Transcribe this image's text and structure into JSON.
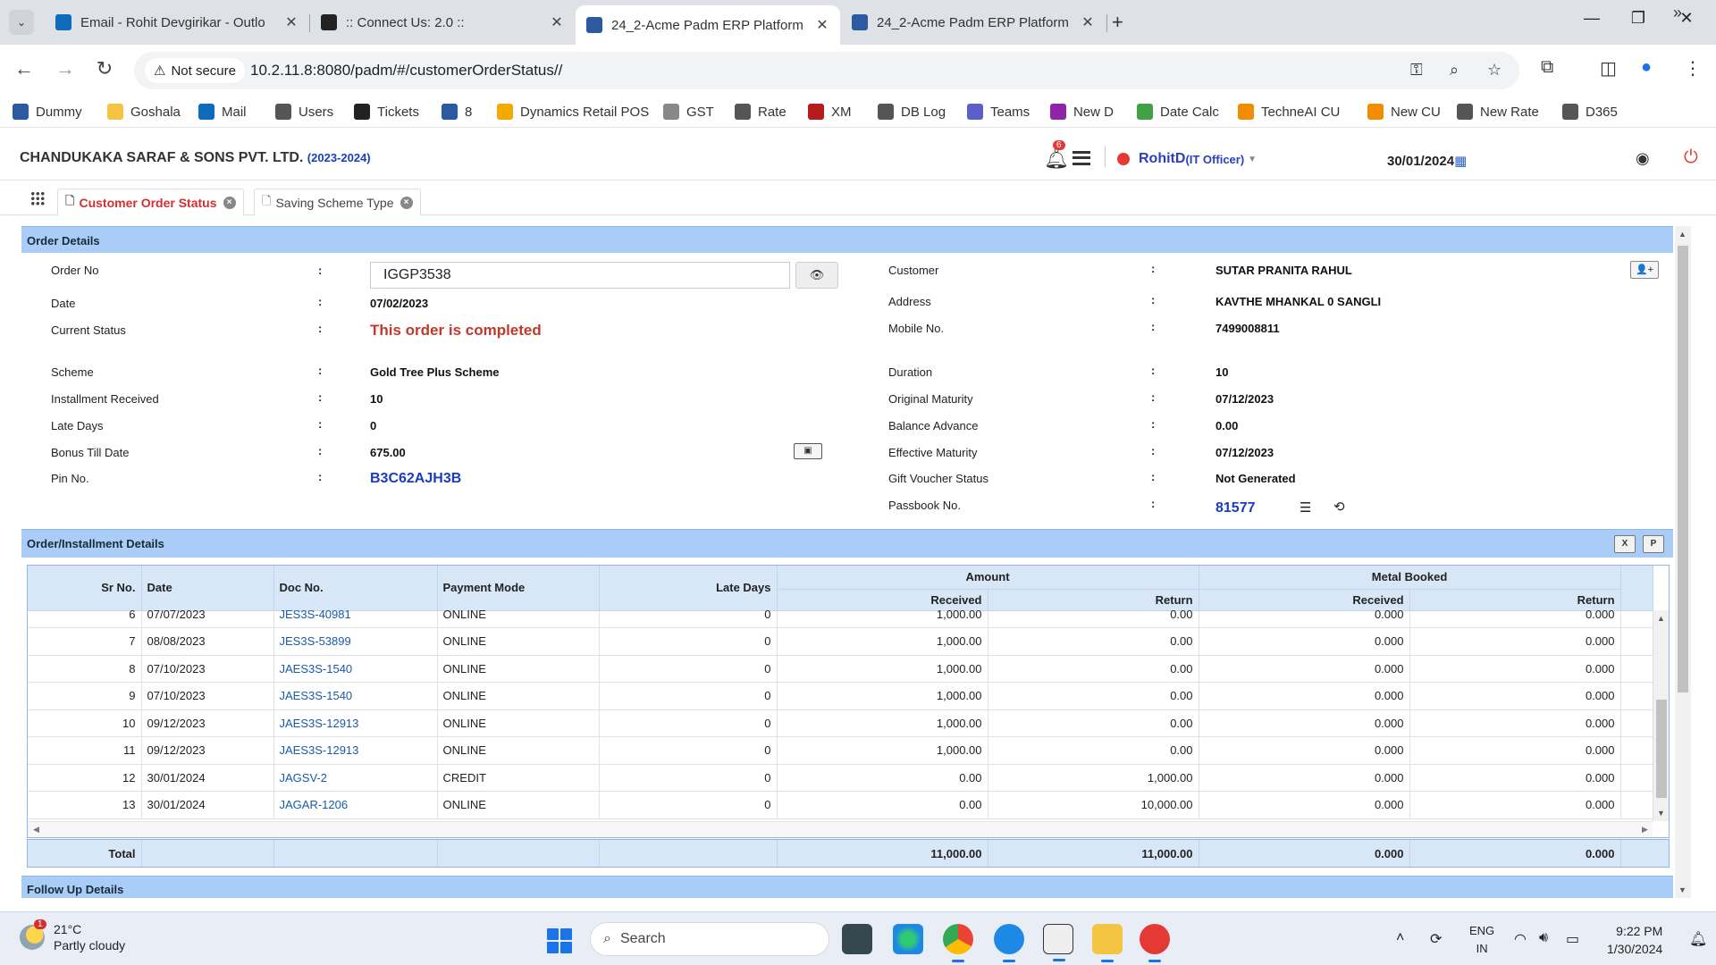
{
  "browser": {
    "tabs": [
      {
        "title": "Email - Rohit Devgirikar - Outlo",
        "color": "#0f6cbd"
      },
      {
        "title": ":: Connect Us: 2.0 ::",
        "color": "#222222"
      },
      {
        "title": "24_2-Acme Padm ERP Platform",
        "color": "#2c5aa0"
      },
      {
        "title": "24_2-Acme Padm ERP Platform",
        "color": "#2c5aa0"
      }
    ],
    "security_label": "Not secure",
    "url": "10.2.11.8:8080/padm/#/customerOrderStatus//"
  },
  "bookmarks": [
    {
      "label": "Dummy",
      "color": "#2c5aa0"
    },
    {
      "label": "Goshala",
      "color": "#f4c542"
    },
    {
      "label": "Mail",
      "color": "#0f6cbd"
    },
    {
      "label": "Users",
      "color": "#555555"
    },
    {
      "label": "Tickets",
      "color": "#222222"
    },
    {
      "label": "8",
      "color": "#2c5aa0"
    },
    {
      "label": "Dynamics Retail POS",
      "color": "#f2a900"
    },
    {
      "label": "GST",
      "color": "#888888"
    },
    {
      "label": "Rate",
      "color": "#555555"
    },
    {
      "label": "XM",
      "color": "#b71c1c"
    },
    {
      "label": "DB Log",
      "color": "#555555"
    },
    {
      "label": "Teams",
      "color": "#5b5fc7"
    },
    {
      "label": "New D",
      "color": "#8e24aa"
    },
    {
      "label": "Date Calc",
      "color": "#43a047"
    },
    {
      "label": "TechneAI CU",
      "color": "#f28c00"
    },
    {
      "label": "New CU",
      "color": "#f28c00"
    },
    {
      "label": "New Rate",
      "color": "#555555"
    },
    {
      "label": "D365",
      "color": "#555555"
    }
  ],
  "header": {
    "company": "CHANDUKAKA SARAF & SONS PVT. LTD.",
    "fiscal_year": "(2023-2024)",
    "notification_count": "6",
    "user_name": "RohitD",
    "user_role": "(IT Officer)",
    "date": "30/01/2024"
  },
  "page_tabs": [
    {
      "label": "Customer Order Status"
    },
    {
      "label": "Saving Scheme Type"
    }
  ],
  "order_details": {
    "section_title": "Order Details",
    "order_no_label": "Order No",
    "order_no": "IGGP3538",
    "date_label": "Date",
    "date": "07/02/2023",
    "status_label": "Current Status",
    "status": "This order is completed",
    "scheme_label": "Scheme",
    "scheme": "Gold Tree Plus Scheme",
    "installment_label": "Installment Received",
    "installment": "10",
    "late_days_label": "Late Days",
    "late_days": "0",
    "bonus_label": "Bonus Till Date",
    "bonus": "675.00",
    "pin_label": "Pin No.",
    "pin": "B3C62AJH3B",
    "customer_label": "Customer",
    "customer": "SUTAR PRANITA RAHUL",
    "address_label": "Address",
    "address": "KAVTHE MHANKAL 0 SANGLI",
    "mobile_label": "Mobile No.",
    "mobile": "7499008811",
    "duration_label": "Duration",
    "duration": "10",
    "orig_maturity_label": "Original Maturity",
    "orig_maturity": "07/12/2023",
    "balance_label": "Balance Advance",
    "balance": "0.00",
    "eff_maturity_label": "Effective Maturity",
    "eff_maturity": "07/12/2023",
    "voucher_label": "Gift Voucher Status",
    "voucher": "Not Generated",
    "passbook_label": "Passbook No.",
    "passbook": "81577"
  },
  "installments": {
    "section_title": "Order/Installment Details",
    "headers": {
      "sr": "Sr No.",
      "date": "Date",
      "doc": "Doc No.",
      "mode": "Payment Mode",
      "late": "Late Days",
      "amount": "Amount",
      "metal": "Metal Booked",
      "received": "Received",
      "return": "Return"
    },
    "rows": [
      {
        "sr": "6",
        "date": "07/07/2023",
        "doc": "JES3S-40981",
        "mode": "ONLINE",
        "late": "0",
        "amt_rec": "1,000.00",
        "amt_ret": "0.00",
        "met_rec": "0.000",
        "met_ret": "0.000"
      },
      {
        "sr": "7",
        "date": "08/08/2023",
        "doc": "JES3S-53899",
        "mode": "ONLINE",
        "late": "0",
        "amt_rec": "1,000.00",
        "amt_ret": "0.00",
        "met_rec": "0.000",
        "met_ret": "0.000"
      },
      {
        "sr": "8",
        "date": "07/10/2023",
        "doc": "JAES3S-1540",
        "mode": "ONLINE",
        "late": "0",
        "amt_rec": "1,000.00",
        "amt_ret": "0.00",
        "met_rec": "0.000",
        "met_ret": "0.000"
      },
      {
        "sr": "9",
        "date": "07/10/2023",
        "doc": "JAES3S-1540",
        "mode": "ONLINE",
        "late": "0",
        "amt_rec": "1,000.00",
        "amt_ret": "0.00",
        "met_rec": "0.000",
        "met_ret": "0.000"
      },
      {
        "sr": "10",
        "date": "09/12/2023",
        "doc": "JAES3S-12913",
        "mode": "ONLINE",
        "late": "0",
        "amt_rec": "1,000.00",
        "amt_ret": "0.00",
        "met_rec": "0.000",
        "met_ret": "0.000"
      },
      {
        "sr": "11",
        "date": "09/12/2023",
        "doc": "JAES3S-12913",
        "mode": "ONLINE",
        "late": "0",
        "amt_rec": "1,000.00",
        "amt_ret": "0.00",
        "met_rec": "0.000",
        "met_ret": "0.000"
      },
      {
        "sr": "12",
        "date": "30/01/2024",
        "doc": "JAGSV-2",
        "mode": "CREDIT",
        "late": "0",
        "amt_rec": "0.00",
        "amt_ret": "1,000.00",
        "met_rec": "0.000",
        "met_ret": "0.000"
      },
      {
        "sr": "13",
        "date": "30/01/2024",
        "doc": "JAGAR-1206",
        "mode": "ONLINE",
        "late": "0",
        "amt_rec": "0.00",
        "amt_ret": "10,000.00",
        "met_rec": "0.000",
        "met_ret": "0.000"
      }
    ],
    "total_label": "Total",
    "totals": {
      "amt_rec": "11,000.00",
      "amt_ret": "11,000.00",
      "met_rec": "0.000",
      "met_ret": "0.000"
    }
  },
  "follow_up": {
    "section_title": "Follow Up Details"
  },
  "taskbar": {
    "temperature": "21°C",
    "weather": "Partly cloudy",
    "weather_badge": "1",
    "search_placeholder": "Search",
    "lang_top": "ENG",
    "lang_bottom": "IN",
    "time": "9:22 PM",
    "date": "1/30/2024"
  }
}
